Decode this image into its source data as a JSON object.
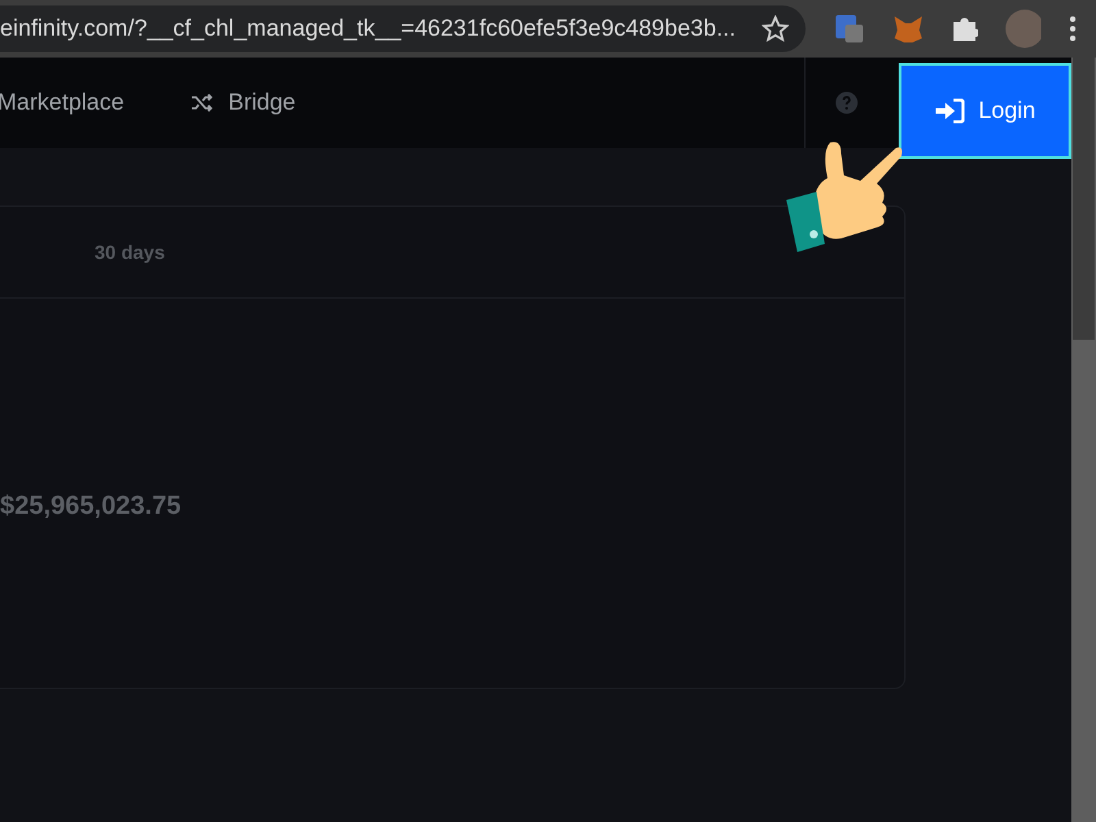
{
  "browser": {
    "url": "einfinity.com/?__cf_chl_managed_tk__=46231fc60efe5f3e9c489be3b..."
  },
  "nav": {
    "items": [
      {
        "label": "Marketplace",
        "kind": "plain"
      },
      {
        "label": "Bridge",
        "kind": "shuffle"
      }
    ],
    "login": "Login"
  },
  "card": {
    "period": "30 days",
    "value": "$25,965,023.75"
  }
}
